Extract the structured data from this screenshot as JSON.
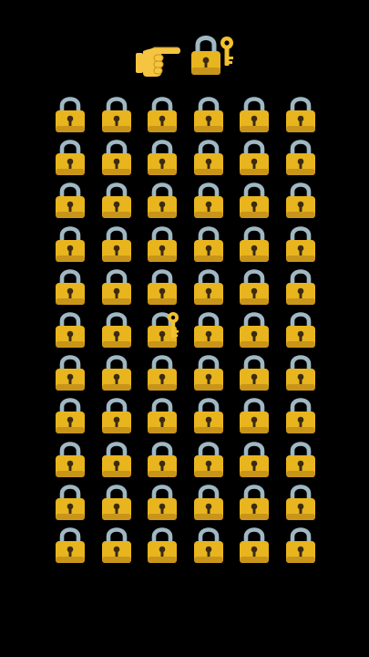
{
  "puzzle": {
    "hint_icons": [
      "pointing-hand-icon",
      "locked-with-key-icon"
    ],
    "grid": {
      "rows": 11,
      "cols": 6,
      "cell_icon": "padlock-icon",
      "odd_icon": "locked-with-key-icon",
      "odd_position": {
        "row": 6,
        "col": 3
      }
    }
  },
  "colors": {
    "background": "#000000",
    "lock_body": "#E8B51F",
    "lock_body_shadow": "#C8951A",
    "shackle": "#9FB8C3",
    "key": "#F2C12E",
    "hand": "#F5C542"
  }
}
